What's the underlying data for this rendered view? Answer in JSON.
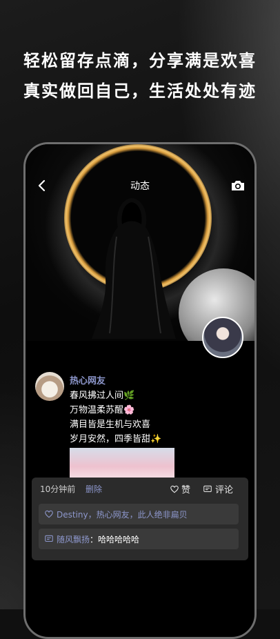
{
  "headline": {
    "line1": "轻松留存点滴，分享满是欢喜",
    "line2": "真实做回自己，生活处处有迹"
  },
  "topbar": {
    "title": "动态"
  },
  "post": {
    "author": "热心网友",
    "lines": [
      "春风拂过人间🌿",
      "万物温柔苏醒🌸",
      "满目皆是生机与欢喜",
      "岁月安然，四季皆甜✨"
    ],
    "time": "10分钟前",
    "delete_label": "删除",
    "like_label": "赞",
    "comment_label": "评论"
  },
  "likes": {
    "names": "Destiny，热心网友，此人绝非扁贝"
  },
  "reply": {
    "author": "随风飘扬",
    "separator": "：",
    "text": "哈哈哈哈哈"
  },
  "icons": {
    "back": "chevron-left-icon",
    "camera": "camera-icon",
    "like": "heart-icon",
    "comment": "comment-icon"
  },
  "colors": {
    "accent": "#8d97cc",
    "panel": "#2b2b2b",
    "ring": "#f2c36a"
  }
}
